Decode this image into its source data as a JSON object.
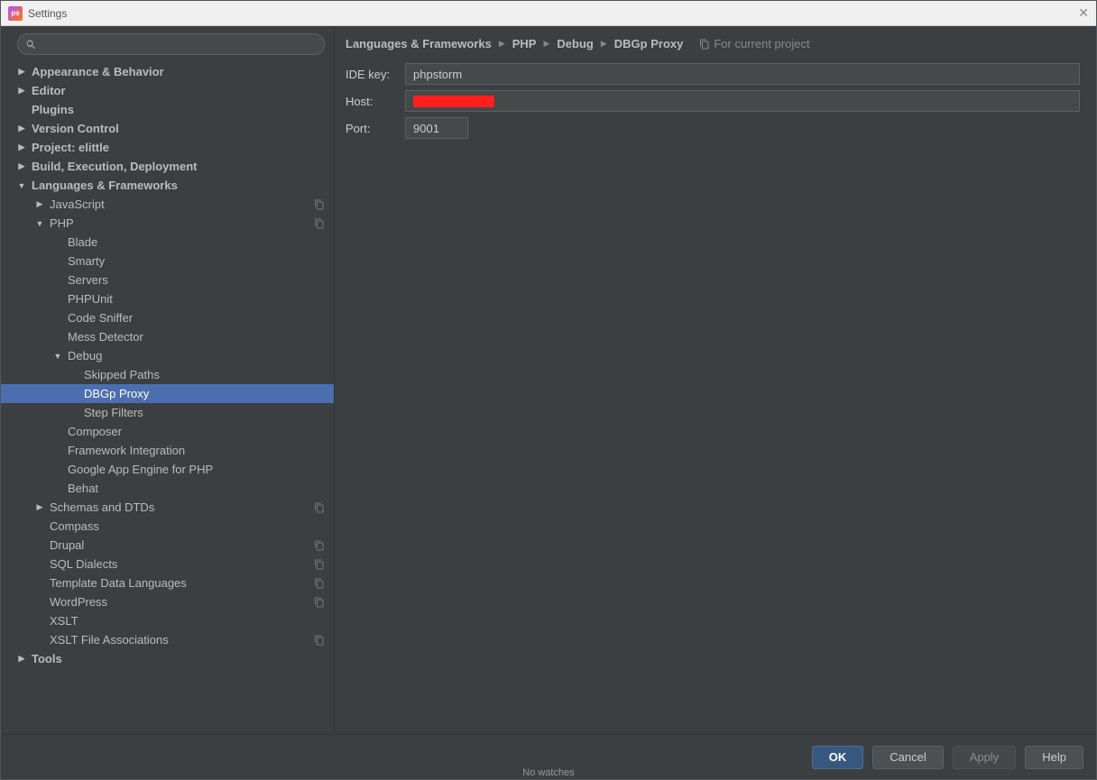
{
  "window": {
    "title": "Settings"
  },
  "search": {
    "placeholder": ""
  },
  "breadcrumb": [
    "Languages & Frameworks",
    "PHP",
    "Debug",
    "DBGp Proxy"
  ],
  "project_hint": "For current project",
  "form": {
    "ide_key_label": "IDE key:",
    "ide_key_value": "phpstorm",
    "host_label": "Host:",
    "port_label": "Port:",
    "port_value": "9001"
  },
  "buttons": {
    "ok": "OK",
    "cancel": "Cancel",
    "apply": "Apply",
    "help": "Help"
  },
  "tree": [
    {
      "label": "Appearance & Behavior",
      "indent": 0,
      "expand": "right",
      "bold": true
    },
    {
      "label": "Editor",
      "indent": 0,
      "expand": "right",
      "bold": true
    },
    {
      "label": "Plugins",
      "indent": 0,
      "expand": "blank",
      "bold": true
    },
    {
      "label": "Version Control",
      "indent": 0,
      "expand": "right",
      "bold": true
    },
    {
      "label": "Project: elittle",
      "indent": 0,
      "expand": "right",
      "bold": true
    },
    {
      "label": "Build, Execution, Deployment",
      "indent": 0,
      "expand": "right",
      "bold": true
    },
    {
      "label": "Languages & Frameworks",
      "indent": 0,
      "expand": "down",
      "bold": true
    },
    {
      "label": "JavaScript",
      "indent": 1,
      "expand": "right",
      "copy": true
    },
    {
      "label": "PHP",
      "indent": 1,
      "expand": "down",
      "copy": true
    },
    {
      "label": "Blade",
      "indent": 2,
      "expand": "blank"
    },
    {
      "label": "Smarty",
      "indent": 2,
      "expand": "blank"
    },
    {
      "label": "Servers",
      "indent": 2,
      "expand": "blank"
    },
    {
      "label": "PHPUnit",
      "indent": 2,
      "expand": "blank"
    },
    {
      "label": "Code Sniffer",
      "indent": 2,
      "expand": "blank"
    },
    {
      "label": "Mess Detector",
      "indent": 2,
      "expand": "blank"
    },
    {
      "label": "Debug",
      "indent": 2,
      "expand": "down"
    },
    {
      "label": "Skipped Paths",
      "indent": 3,
      "expand": "blank"
    },
    {
      "label": "DBGp Proxy",
      "indent": 3,
      "expand": "blank",
      "selected": true
    },
    {
      "label": "Step Filters",
      "indent": 3,
      "expand": "blank"
    },
    {
      "label": "Composer",
      "indent": 2,
      "expand": "blank"
    },
    {
      "label": "Framework Integration",
      "indent": 2,
      "expand": "blank"
    },
    {
      "label": "Google App Engine for PHP",
      "indent": 2,
      "expand": "blank"
    },
    {
      "label": "Behat",
      "indent": 2,
      "expand": "blank"
    },
    {
      "label": "Schemas and DTDs",
      "indent": 1,
      "expand": "right",
      "copy": true
    },
    {
      "label": "Compass",
      "indent": 1,
      "expand": "blank"
    },
    {
      "label": "Drupal",
      "indent": 1,
      "expand": "blank",
      "copy": true
    },
    {
      "label": "SQL Dialects",
      "indent": 1,
      "expand": "blank",
      "copy": true
    },
    {
      "label": "Template Data Languages",
      "indent": 1,
      "expand": "blank",
      "copy": true
    },
    {
      "label": "WordPress",
      "indent": 1,
      "expand": "blank",
      "copy": true
    },
    {
      "label": "XSLT",
      "indent": 1,
      "expand": "blank"
    },
    {
      "label": "XSLT File Associations",
      "indent": 1,
      "expand": "blank",
      "copy": true
    },
    {
      "label": "Tools",
      "indent": 0,
      "expand": "right",
      "bold": true
    }
  ],
  "bottom_text": "No watches"
}
